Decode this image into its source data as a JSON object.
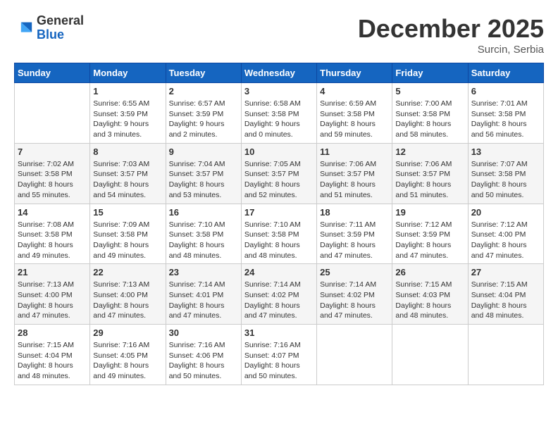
{
  "header": {
    "logo_line1": "General",
    "logo_line2": "Blue",
    "month": "December 2025",
    "location": "Surcin, Serbia"
  },
  "weekdays": [
    "Sunday",
    "Monday",
    "Tuesday",
    "Wednesday",
    "Thursday",
    "Friday",
    "Saturday"
  ],
  "weeks": [
    [
      {
        "day": "",
        "info": ""
      },
      {
        "day": "1",
        "info": "Sunrise: 6:55 AM\nSunset: 3:59 PM\nDaylight: 9 hours\nand 3 minutes."
      },
      {
        "day": "2",
        "info": "Sunrise: 6:57 AM\nSunset: 3:59 PM\nDaylight: 9 hours\nand 2 minutes."
      },
      {
        "day": "3",
        "info": "Sunrise: 6:58 AM\nSunset: 3:58 PM\nDaylight: 9 hours\nand 0 minutes."
      },
      {
        "day": "4",
        "info": "Sunrise: 6:59 AM\nSunset: 3:58 PM\nDaylight: 8 hours\nand 59 minutes."
      },
      {
        "day": "5",
        "info": "Sunrise: 7:00 AM\nSunset: 3:58 PM\nDaylight: 8 hours\nand 58 minutes."
      },
      {
        "day": "6",
        "info": "Sunrise: 7:01 AM\nSunset: 3:58 PM\nDaylight: 8 hours\nand 56 minutes."
      }
    ],
    [
      {
        "day": "7",
        "info": "Sunrise: 7:02 AM\nSunset: 3:58 PM\nDaylight: 8 hours\nand 55 minutes."
      },
      {
        "day": "8",
        "info": "Sunrise: 7:03 AM\nSunset: 3:57 PM\nDaylight: 8 hours\nand 54 minutes."
      },
      {
        "day": "9",
        "info": "Sunrise: 7:04 AM\nSunset: 3:57 PM\nDaylight: 8 hours\nand 53 minutes."
      },
      {
        "day": "10",
        "info": "Sunrise: 7:05 AM\nSunset: 3:57 PM\nDaylight: 8 hours\nand 52 minutes."
      },
      {
        "day": "11",
        "info": "Sunrise: 7:06 AM\nSunset: 3:57 PM\nDaylight: 8 hours\nand 51 minutes."
      },
      {
        "day": "12",
        "info": "Sunrise: 7:06 AM\nSunset: 3:57 PM\nDaylight: 8 hours\nand 51 minutes."
      },
      {
        "day": "13",
        "info": "Sunrise: 7:07 AM\nSunset: 3:58 PM\nDaylight: 8 hours\nand 50 minutes."
      }
    ],
    [
      {
        "day": "14",
        "info": "Sunrise: 7:08 AM\nSunset: 3:58 PM\nDaylight: 8 hours\nand 49 minutes."
      },
      {
        "day": "15",
        "info": "Sunrise: 7:09 AM\nSunset: 3:58 PM\nDaylight: 8 hours\nand 49 minutes."
      },
      {
        "day": "16",
        "info": "Sunrise: 7:10 AM\nSunset: 3:58 PM\nDaylight: 8 hours\nand 48 minutes."
      },
      {
        "day": "17",
        "info": "Sunrise: 7:10 AM\nSunset: 3:58 PM\nDaylight: 8 hours\nand 48 minutes."
      },
      {
        "day": "18",
        "info": "Sunrise: 7:11 AM\nSunset: 3:59 PM\nDaylight: 8 hours\nand 47 minutes."
      },
      {
        "day": "19",
        "info": "Sunrise: 7:12 AM\nSunset: 3:59 PM\nDaylight: 8 hours\nand 47 minutes."
      },
      {
        "day": "20",
        "info": "Sunrise: 7:12 AM\nSunset: 4:00 PM\nDaylight: 8 hours\nand 47 minutes."
      }
    ],
    [
      {
        "day": "21",
        "info": "Sunrise: 7:13 AM\nSunset: 4:00 PM\nDaylight: 8 hours\nand 47 minutes."
      },
      {
        "day": "22",
        "info": "Sunrise: 7:13 AM\nSunset: 4:00 PM\nDaylight: 8 hours\nand 47 minutes."
      },
      {
        "day": "23",
        "info": "Sunrise: 7:14 AM\nSunset: 4:01 PM\nDaylight: 8 hours\nand 47 minutes."
      },
      {
        "day": "24",
        "info": "Sunrise: 7:14 AM\nSunset: 4:02 PM\nDaylight: 8 hours\nand 47 minutes."
      },
      {
        "day": "25",
        "info": "Sunrise: 7:14 AM\nSunset: 4:02 PM\nDaylight: 8 hours\nand 47 minutes."
      },
      {
        "day": "26",
        "info": "Sunrise: 7:15 AM\nSunset: 4:03 PM\nDaylight: 8 hours\nand 48 minutes."
      },
      {
        "day": "27",
        "info": "Sunrise: 7:15 AM\nSunset: 4:04 PM\nDaylight: 8 hours\nand 48 minutes."
      }
    ],
    [
      {
        "day": "28",
        "info": "Sunrise: 7:15 AM\nSunset: 4:04 PM\nDaylight: 8 hours\nand 48 minutes."
      },
      {
        "day": "29",
        "info": "Sunrise: 7:16 AM\nSunset: 4:05 PM\nDaylight: 8 hours\nand 49 minutes."
      },
      {
        "day": "30",
        "info": "Sunrise: 7:16 AM\nSunset: 4:06 PM\nDaylight: 8 hours\nand 50 minutes."
      },
      {
        "day": "31",
        "info": "Sunrise: 7:16 AM\nSunset: 4:07 PM\nDaylight: 8 hours\nand 50 minutes."
      },
      {
        "day": "",
        "info": ""
      },
      {
        "day": "",
        "info": ""
      },
      {
        "day": "",
        "info": ""
      }
    ]
  ]
}
